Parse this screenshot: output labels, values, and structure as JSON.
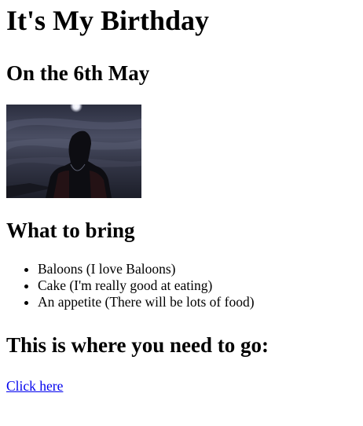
{
  "page": {
    "title": "It's My Birthday",
    "date_heading": "On the 6th May",
    "image": {
      "icon": "night-sky-portrait-photo"
    },
    "bring_heading": "What to bring",
    "bring_items": [
      "Baloons (I love Baloons)",
      "Cake (I'm really good at eating)",
      "An appetite (There will be lots of food)"
    ],
    "go_heading": "This is where you need to go:",
    "link_text": "Click here"
  },
  "colors": {
    "link": "#0000ee",
    "text": "#000000",
    "background": "#ffffff"
  }
}
